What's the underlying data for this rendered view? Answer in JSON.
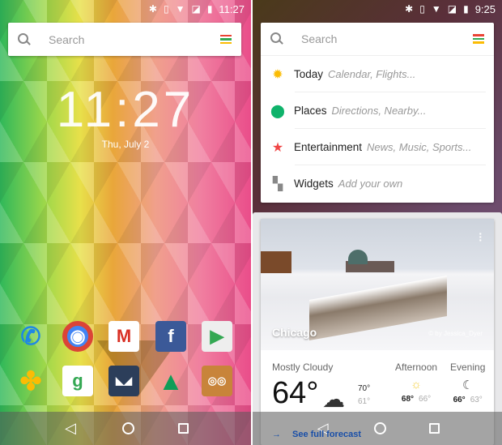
{
  "left": {
    "status": {
      "time": "11:27",
      "icons": [
        "bluetooth-icon",
        "vibrate-icon",
        "wifi-icon",
        "no-sim-icon",
        "battery-icon"
      ]
    },
    "search": {
      "placeholder": "Search"
    },
    "clock": {
      "time": "11:27",
      "date": "Thu, July 2"
    },
    "apps": [
      {
        "name": "Phone",
        "icon": "phone-icon",
        "color": "#1e88e5"
      },
      {
        "name": "Chrome",
        "icon": "chrome-icon",
        "color": "#4285f4"
      },
      {
        "name": "Gmail",
        "icon": "gmail-icon",
        "color": "#d93025"
      },
      {
        "name": "Facebook",
        "icon": "facebook-icon",
        "color": "#3b5998"
      },
      {
        "name": "Play Store",
        "icon": "play-store-icon",
        "color": "#eeeeee"
      },
      {
        "name": "Photos",
        "icon": "photos-icon",
        "color": "#fbbc04"
      },
      {
        "name": "Maps",
        "icon": "maps-icon",
        "color": "#34a853"
      },
      {
        "name": "Falcon",
        "icon": "falcon-icon",
        "color": "#2c3e5a"
      },
      {
        "name": "Drive",
        "icon": "drive-icon",
        "color": "#0f9d58"
      },
      {
        "name": "Cardboard",
        "icon": "cardboard-icon",
        "color": "#c8843a"
      }
    ]
  },
  "right": {
    "status": {
      "time": "9:25"
    },
    "search": {
      "placeholder": "Search"
    },
    "menu": [
      {
        "label": "Today",
        "hint": "Calendar, Flights...",
        "icon": "sun-icon",
        "color": "#fbbc04"
      },
      {
        "label": "Places",
        "hint": "Directions, Nearby...",
        "icon": "location-pin-icon",
        "color": "#0fb36b"
      },
      {
        "label": "Entertainment",
        "hint": "News, Music, Sports...",
        "icon": "star-icon",
        "color": "#f04646"
      },
      {
        "label": "Widgets",
        "hint": "Add your own",
        "icon": "widgets-icon",
        "color": "#888888"
      }
    ],
    "weather": {
      "city": "Chicago",
      "credit": "© by Jessica_Dyer",
      "condition": "Mostly Cloudy",
      "temp": "64°",
      "high": "70°",
      "low": "61°",
      "forecast": [
        {
          "label": "Afternoon",
          "icon": "sun-icon",
          "high": "68°",
          "low": "66°"
        },
        {
          "label": "Evening",
          "icon": "partly-cloudy-night-icon",
          "high": "66°",
          "low": "63°"
        }
      ],
      "link": "See full forecast"
    }
  },
  "colors": {
    "google_bars": [
      "#ea4335",
      "#34a853",
      "#fbbc04"
    ]
  }
}
